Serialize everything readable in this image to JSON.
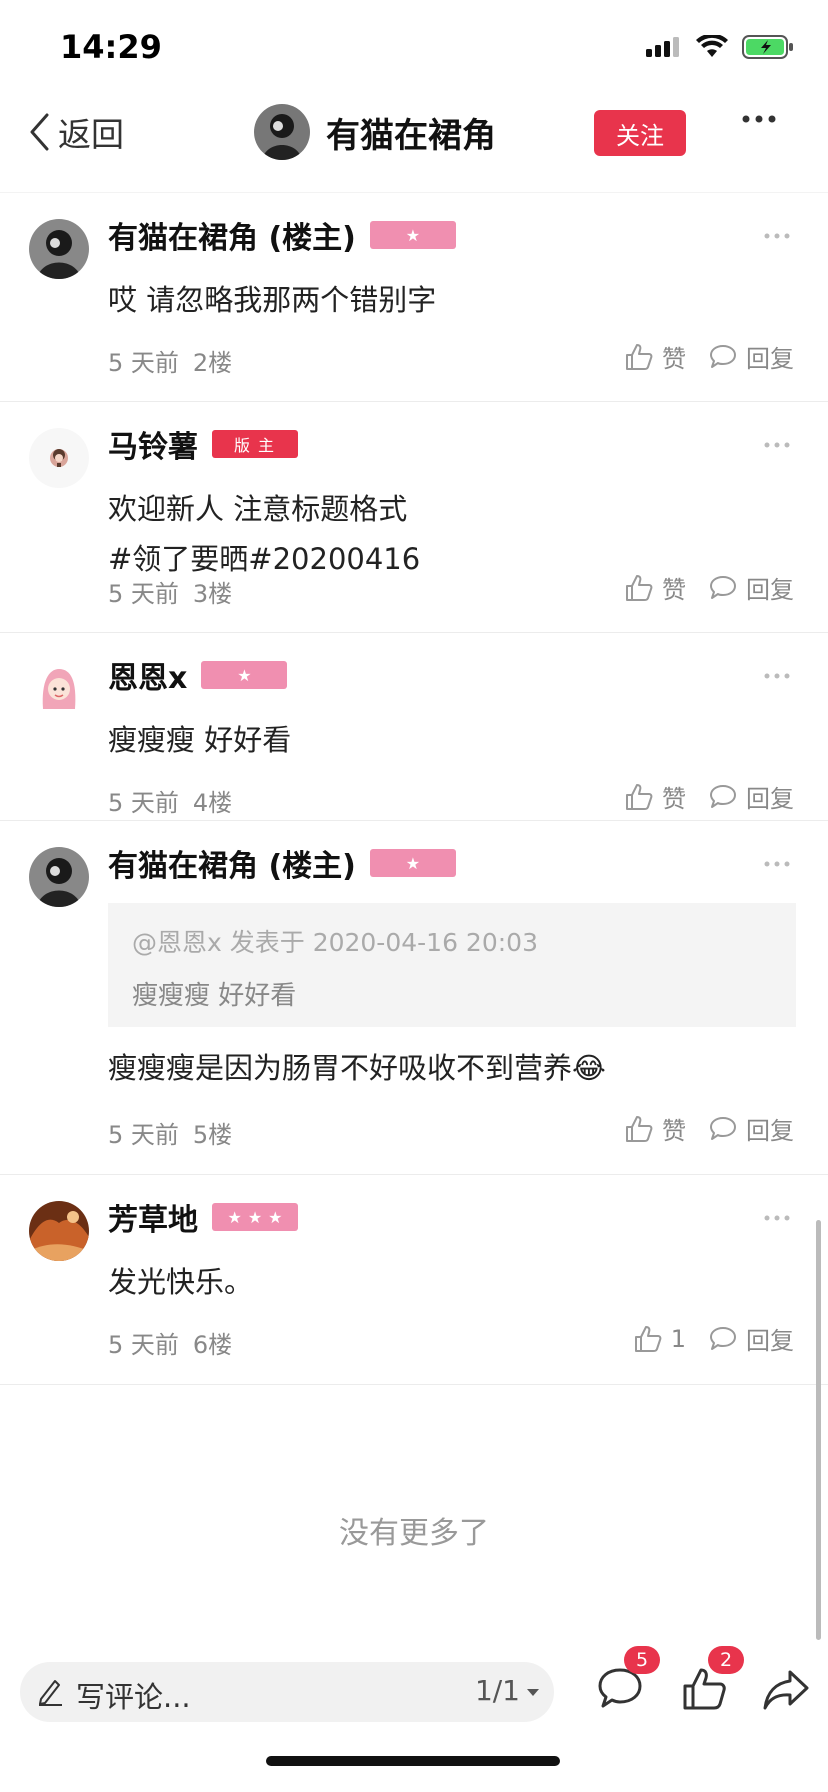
{
  "status_bar": {
    "time": "14:29"
  },
  "nav": {
    "back_label": "返回",
    "title": "有猫在裙角",
    "follow_label": "关注"
  },
  "colors": {
    "accent": "#e8344c",
    "star_badge": "#f08fb0"
  },
  "posts": [
    {
      "name": "有猫在裙角 (楼主)",
      "badge": "star",
      "stars": 1,
      "lines": [
        "哎 请忽略我那两个错别字"
      ],
      "time": "5 天前",
      "floor": "2楼",
      "like_label": "赞",
      "reply_label": "回复"
    },
    {
      "name": "马铃薯",
      "badge": "mod",
      "badge_text": "版主",
      "lines": [
        "欢迎新人 注意标题格式",
        "#领了要晒#20200416"
      ],
      "time": "5 天前",
      "floor": "3楼",
      "like_label": "赞",
      "reply_label": "回复"
    },
    {
      "name": "恩恩x",
      "badge": "star",
      "stars": 1,
      "lines": [
        "瘦瘦瘦 好好看"
      ],
      "time": "5 天前",
      "floor": "4楼",
      "like_label": "赞",
      "reply_label": "回复"
    },
    {
      "name": "有猫在裙角 (楼主)",
      "badge": "star",
      "stars": 1,
      "quote": {
        "meta": "@恩恩x 发表于 2020-04-16 20:03",
        "text": "瘦瘦瘦 好好看"
      },
      "lines": [
        "瘦瘦瘦是因为肠胃不好吸收不到营养😂"
      ],
      "time": "5 天前",
      "floor": "5楼",
      "like_label": "赞",
      "reply_label": "回复"
    },
    {
      "name": "芳草地",
      "badge": "star",
      "stars": 3,
      "lines": [
        "发光快乐。"
      ],
      "time": "5 天前",
      "floor": "6楼",
      "like_label": "1",
      "reply_label": "回复"
    }
  ],
  "no_more": "没有更多了",
  "bottom_bar": {
    "comment_placeholder": "写评论...",
    "page_indicator": "1/1",
    "comment_count": "5",
    "like_count": "2"
  },
  "icons": [
    "back-chevron-icon",
    "more-dots-icon",
    "like-thumb-icon",
    "comment-bubble-icon",
    "pen-icon",
    "share-arrow-icon",
    "signal-icon",
    "wifi-icon",
    "battery-icon"
  ]
}
